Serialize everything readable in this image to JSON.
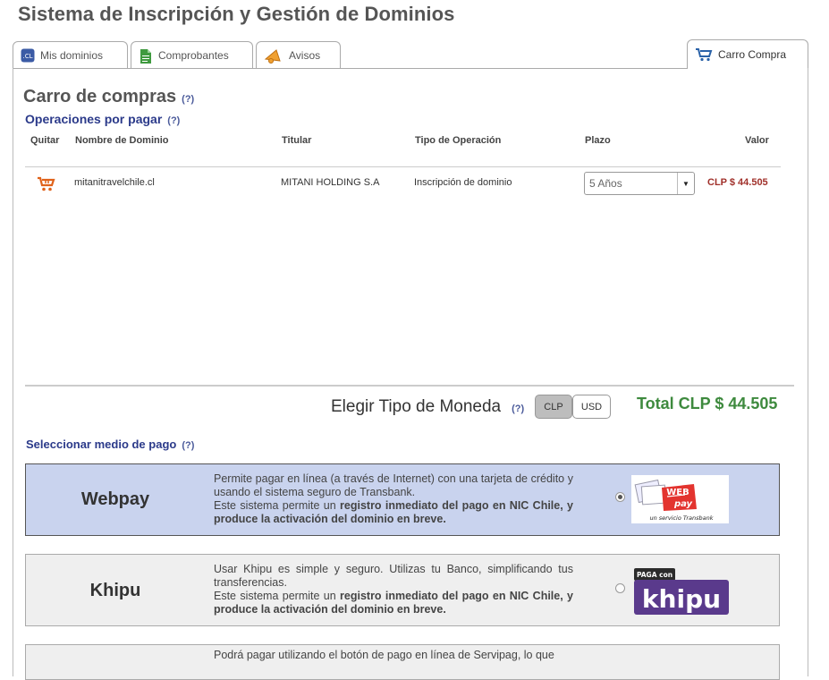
{
  "page": {
    "title": "Sistema de Inscripción y Gestión de Dominios"
  },
  "tabs": [
    {
      "label": "Mis dominios",
      "icon": "cl-domain-icon"
    },
    {
      "label": "Comprobantes",
      "icon": "document-icon"
    },
    {
      "label": "Avisos",
      "icon": "megaphone-icon"
    },
    {
      "label": "Carro Compra",
      "icon": "shopping-cart-icon",
      "active": true
    }
  ],
  "cart": {
    "heading": "Carro de compras",
    "help": "(?)",
    "operations_heading": "Operaciones por pagar",
    "columns": [
      "Quitar",
      "Nombre de Dominio",
      "Titular",
      "Tipo de Operación",
      "Plazo",
      "Valor"
    ],
    "rows": [
      {
        "domain": "mitanitravelchile.cl",
        "holder": "MITANI HOLDING S.A",
        "operation": "Inscripción de dominio",
        "term": "5 Años",
        "value": "CLP $ 44.505"
      }
    ]
  },
  "currency": {
    "label": "Elegir Tipo de Moneda",
    "help": "(?)",
    "options": [
      "CLP",
      "USD"
    ],
    "selected": "CLP",
    "total": "Total CLP $ 44.505"
  },
  "payment": {
    "heading": "Seleccionar medio de pago",
    "help": "(?)",
    "methods": [
      {
        "name": "Webpay",
        "desc1": "Permite pagar en línea (a través de Internet) con una tarjeta de crédito y usando el sistema seguro de Transbank.",
        "desc2_pre": "Este sistema permite un ",
        "desc2_bold": "registro inmediato del pago en NIC Chile, y produce la activación del dominio en breve.",
        "selected": true,
        "logo_text": "WEB pay",
        "logo_sub": "un servicio Transbank",
        "color": "#c9d3ee"
      },
      {
        "name": "Khipu",
        "desc1": "Usar Khipu es simple y seguro. Utilizas tu Banco, simplificando tus transferencias.",
        "desc2_pre": "Este sistema permite un ",
        "desc2_bold": "registro inmediato del pago en NIC Chile, y produce la activación del dominio en breve.",
        "selected": false,
        "logo_badge": "PAGA con",
        "logo_text": "khipu",
        "color": "#efefef"
      },
      {
        "name": "",
        "desc1": "Podrá pagar utilizando el botón de pago en línea de Servipag, lo que",
        "color": "#efefef"
      }
    ]
  },
  "colors": {
    "accent": "#2b3a8a",
    "total": "#3e8a3e",
    "price": "#a0302a",
    "webpay_bg": "#c9d3ee"
  }
}
